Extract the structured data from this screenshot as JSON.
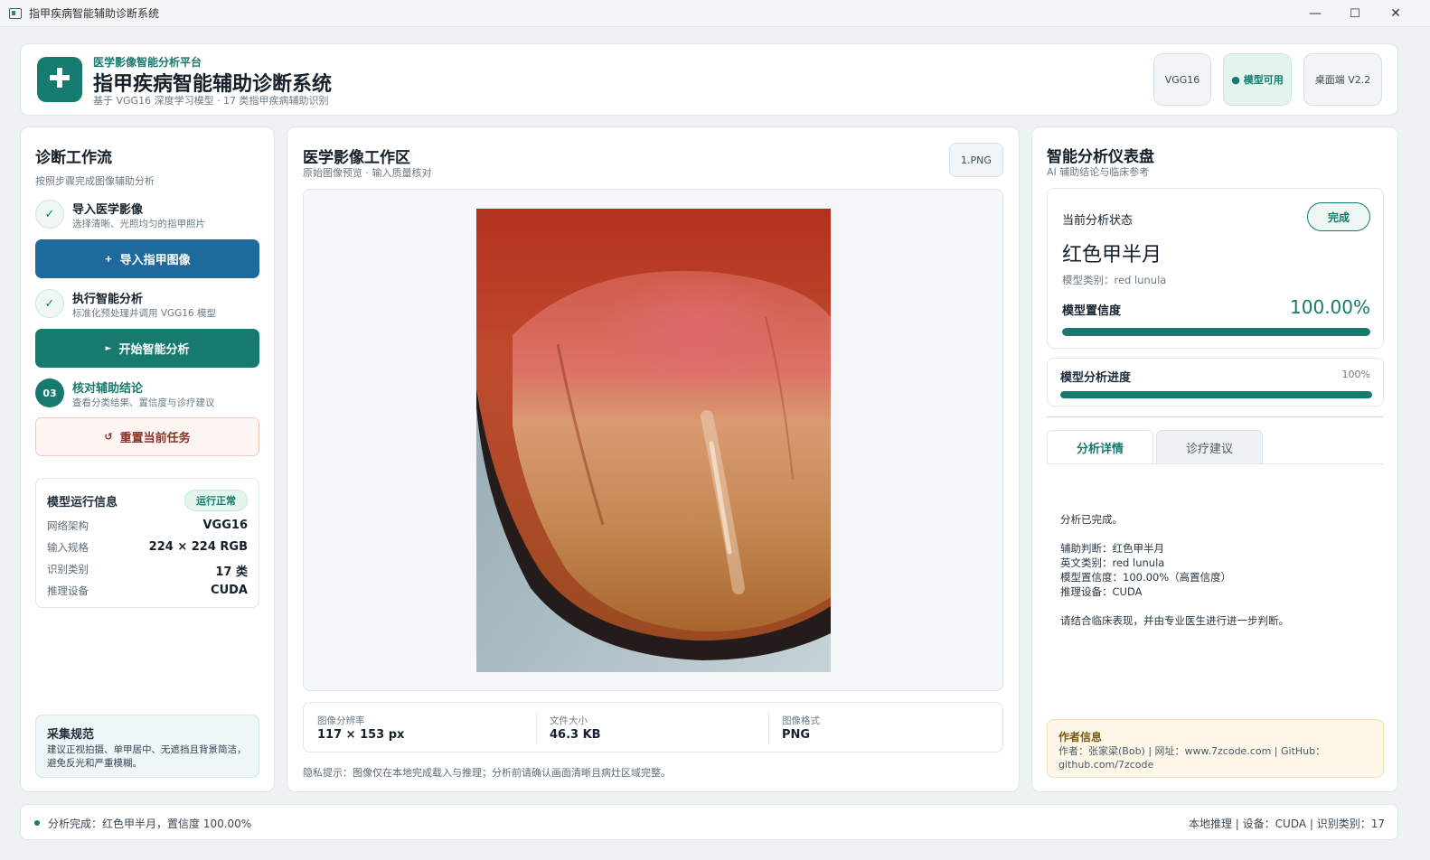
{
  "window": {
    "title": "指甲疾病智能辅助诊断系统",
    "controls": {
      "minimize": "—",
      "maximize": "☐",
      "close": "✕"
    }
  },
  "header": {
    "kicker": "医学影像智能分析平台",
    "title": "指甲疾病智能辅助诊断系统",
    "subtitle": "基于 VGG16 深度学习模型 · 17 类指甲疾病辅助识别",
    "pills": {
      "model": "VGG16",
      "status": "● 模型可用",
      "version": "桌面端 V2.2"
    }
  },
  "left": {
    "title": "诊断工作流",
    "subtitle": "按照步骤完成图像辅助分析",
    "steps": [
      {
        "badge": "✓",
        "title": "导入医学影像",
        "desc": "选择清晰、光照均匀的指甲照片"
      },
      {
        "badge": "✓",
        "title": "执行智能分析",
        "desc": "标准化预处理并调用 VGG16 模型"
      },
      {
        "badge": "03",
        "title": "核对辅助结论",
        "desc": "查看分类结果、置信度与诊疗建议"
      }
    ],
    "buttons": {
      "import": "导入指甲图像",
      "import_icon": "+",
      "analyze": "开始智能分析",
      "analyze_icon": "►",
      "reset": "重置当前任务",
      "reset_icon": "↺"
    },
    "model_info": {
      "title": "模型运行信息",
      "badge": "运行正常",
      "rows": [
        {
          "k": "网络架构",
          "v": "VGG16"
        },
        {
          "k": "输入规格",
          "v": "224 × 224 RGB"
        },
        {
          "k": "识别类别",
          "v": "17 类"
        },
        {
          "k": "推理设备",
          "v": "CUDA"
        }
      ]
    },
    "spec": {
      "title": "采集规范",
      "text": "建议正视拍摄、单甲居中、无遮挡且背景简洁，避免反光和严重模糊。"
    }
  },
  "center": {
    "title": "医学影像工作区",
    "subtitle": "原始图像预览 · 输入质量核对",
    "file_chip": "1.PNG",
    "meta": [
      {
        "k": "图像分辨率",
        "v": "117 × 153 px"
      },
      {
        "k": "文件大小",
        "v": "46.3 KB"
      },
      {
        "k": "图像格式",
        "v": "PNG"
      }
    ],
    "privacy": "隐私提示：图像仅在本地完成载入与推理；分析前请确认画面清晰且病灶区域完整。"
  },
  "right": {
    "title": "智能分析仪表盘",
    "subtitle": "AI 辅助结论与临床参考",
    "status": {
      "label": "当前分析状态",
      "state": "完成",
      "diagnosis": "红色甲半月",
      "class_line": "模型类别：red lunula",
      "confidence_label": "模型置信度",
      "confidence": "100.00%",
      "confidence_fraction": 1.0
    },
    "progress": {
      "label": "模型分析进度",
      "percent_text": "100%",
      "fraction": 1.0
    },
    "tabs": [
      "分析详情",
      "诊疗建议"
    ],
    "detail": "分析已完成。\n\n辅助判断：红色甲半月\n英文类别：red lunula\n模型置信度：100.00%（高置信度）\n推理设备：CUDA\n\n请结合临床表现，并由专业医生进行进一步判断。",
    "author": {
      "title": "作者信息",
      "text": "作者：张家梁(Bob)  |  网址：www.7zcode.com  |  GitHub：github.com/7zcode"
    }
  },
  "statusbar": {
    "message": "分析完成：红色甲半月，置信度 100.00%",
    "right": "本地推理  |  设备：CUDA  |  识别类别：17"
  },
  "colors": {
    "primary": "#167a6f",
    "blue": "#1f6a9c",
    "danger": "#8c2f24",
    "background": "#eef2f3"
  }
}
